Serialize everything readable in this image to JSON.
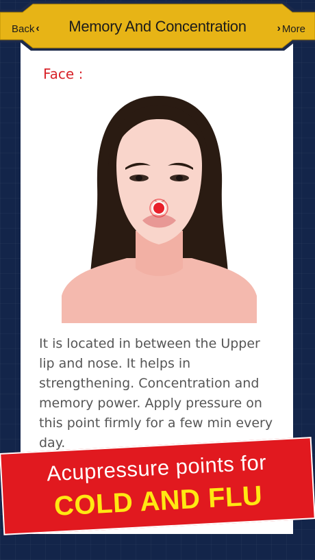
{
  "header": {
    "back_label": "Back",
    "title": "Memory And Concentration",
    "more_label": "More"
  },
  "content": {
    "section_label": "Face :",
    "description": "It is located in between the Upper lip and nose. It helps in strengthening. Concentration and memory power. Apply pressure on this point firmly for a few min every day."
  },
  "banner": {
    "line1": "Acupressure points for",
    "line2": "COLD AND FLU"
  },
  "colors": {
    "header_gold": "#e7b416",
    "banner_red": "#e1191f",
    "banner_yellow": "#ffe812",
    "label_red": "#d8232a",
    "point_red": "#e8202a"
  },
  "icons": [
    "chevron-left-icon",
    "chevron-right-icon",
    "acupressure-point-icon"
  ]
}
